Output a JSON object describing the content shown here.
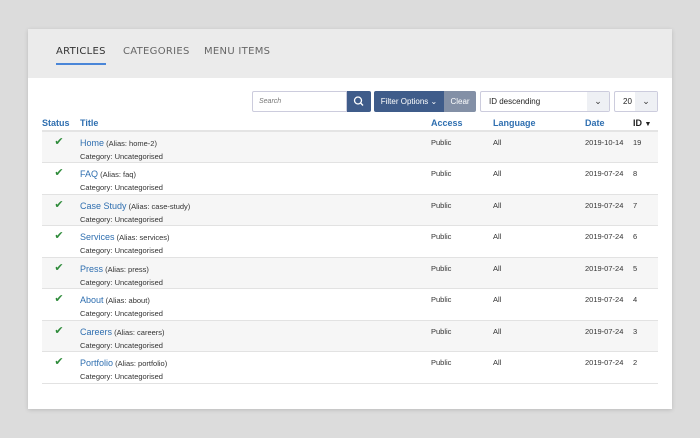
{
  "tabs": [
    {
      "label": "ARTICLES",
      "active": true
    },
    {
      "label": "CATEGORIES"
    },
    {
      "label": "MENU ITEMS"
    }
  ],
  "toolbar": {
    "search_placeholder": "Search",
    "search_icon": "magnifier-icon",
    "filter_label": "Filter Options",
    "clear_label": "Clear",
    "sort_value": "ID descending",
    "limit_value": "20"
  },
  "columns": {
    "status": "Status",
    "title": "Title",
    "access": "Access",
    "language": "Language",
    "date": "Date",
    "id": "ID"
  },
  "colors": {
    "accent": "#3f5c8a",
    "link": "#2f6fb0",
    "published": "#2e8b3a"
  },
  "rows": [
    {
      "title": "Home",
      "alias": "(Alias: home-2)",
      "category": "Category: Uncategorised",
      "access": "Public",
      "language": "All",
      "date": "2019-10-14",
      "id": "19"
    },
    {
      "title": "FAQ",
      "alias": "(Alias: faq)",
      "category": "Category: Uncategorised",
      "access": "Public",
      "language": "All",
      "date": "2019-07-24",
      "id": "8"
    },
    {
      "title": "Case Study",
      "alias": "(Alias: case-study)",
      "category": "Category: Uncategorised",
      "access": "Public",
      "language": "All",
      "date": "2019-07-24",
      "id": "7"
    },
    {
      "title": "Services",
      "alias": "(Alias: services)",
      "category": "Category: Uncategorised",
      "access": "Public",
      "language": "All",
      "date": "2019-07-24",
      "id": "6"
    },
    {
      "title": "Press",
      "alias": "(Alias: press)",
      "category": "Category: Uncategorised",
      "access": "Public",
      "language": "All",
      "date": "2019-07-24",
      "id": "5"
    },
    {
      "title": "About",
      "alias": "(Alias: about)",
      "category": "Category: Uncategorised",
      "access": "Public",
      "language": "All",
      "date": "2019-07-24",
      "id": "4"
    },
    {
      "title": "Careers",
      "alias": "(Alias: careers)",
      "category": "Category: Uncategorised",
      "access": "Public",
      "language": "All",
      "date": "2019-07-24",
      "id": "3"
    },
    {
      "title": "Portfolio",
      "alias": "(Alias: portfolio)",
      "category": "Category: Uncategorised",
      "access": "Public",
      "language": "All",
      "date": "2019-07-24",
      "id": "2"
    }
  ]
}
